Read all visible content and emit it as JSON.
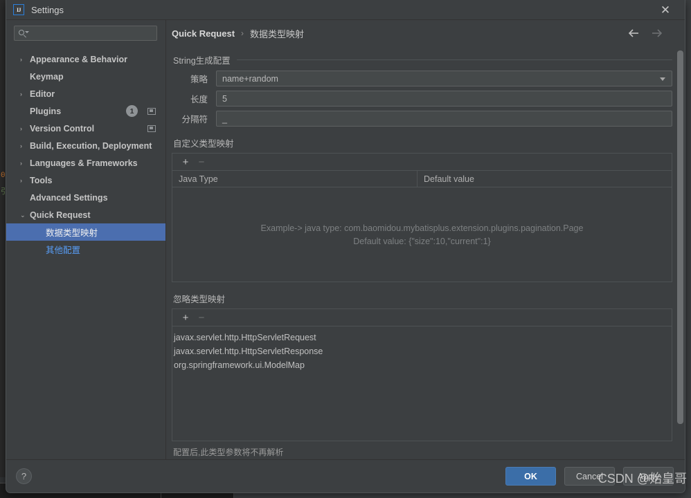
{
  "window": {
    "title": "Settings",
    "logo_text": "IJ",
    "close_icon": "✕"
  },
  "sidebar": {
    "search": {
      "value": "",
      "placeholder": ""
    },
    "items": [
      {
        "label": "Appearance & Behavior",
        "twisty": "›",
        "bold": true,
        "level": 0
      },
      {
        "label": "Keymap",
        "twisty": "",
        "bold": true,
        "level": 0
      },
      {
        "label": "Editor",
        "twisty": "›",
        "bold": true,
        "level": 0
      },
      {
        "label": "Plugins",
        "twisty": "",
        "bold": true,
        "level": 0,
        "badge": "1",
        "window_icon": true
      },
      {
        "label": "Version Control",
        "twisty": "›",
        "bold": true,
        "level": 0,
        "window_icon": true
      },
      {
        "label": "Build, Execution, Deployment",
        "twisty": "›",
        "bold": true,
        "level": 0
      },
      {
        "label": "Languages & Frameworks",
        "twisty": "›",
        "bold": true,
        "level": 0
      },
      {
        "label": "Tools",
        "twisty": "›",
        "bold": true,
        "level": 0
      },
      {
        "label": "Advanced Settings",
        "twisty": "",
        "bold": true,
        "level": 0
      },
      {
        "label": "Quick Request",
        "twisty": "⌄",
        "bold": true,
        "level": 0,
        "expanded": true
      },
      {
        "label": "数据类型映射",
        "twisty": "",
        "bold": false,
        "level": 1,
        "selected": true
      },
      {
        "label": "其他配置",
        "twisty": "",
        "bold": false,
        "level": 1,
        "link": true
      }
    ]
  },
  "breadcrumb": {
    "root": "Quick Request",
    "separator": "›",
    "leaf": "数据类型映射",
    "back_icon": "arrow-left",
    "forward_icon": "arrow-right"
  },
  "string_config": {
    "group_title": "String生成配置",
    "fields": [
      {
        "label": "策略",
        "value": "name+random",
        "type": "combo"
      },
      {
        "label": "长度",
        "value": "5",
        "type": "text"
      },
      {
        "label": "分隔符",
        "value": "_",
        "type": "text"
      }
    ]
  },
  "custom_mapping": {
    "section_label": "自定义类型映射",
    "add_label": "+",
    "remove_label": "−",
    "columns": [
      "Java Type",
      "Default value"
    ],
    "rows": [],
    "empty_hint_line1": "Example-> java type: com.baomidou.mybatisplus.extension.plugins.pagination.Page",
    "empty_hint_line2": "Default value: {\"size\":10,\"current\":1}"
  },
  "ignore_mapping": {
    "section_label": "忽略类型映射",
    "add_label": "+",
    "remove_label": "−",
    "items": [
      "javax.servlet.http.HttpServletRequest",
      "javax.servlet.http.HttpServletResponse",
      "org.springframework.ui.ModelMap"
    ],
    "note": "配置后,此类型参数将不再解析"
  },
  "footer": {
    "help_label": "?",
    "ok_label": "OK",
    "cancel_label": "Cancel",
    "apply_label": "Apply"
  },
  "watermark": "CSDN @始皇哥",
  "ide_background": {
    "code_line_1": "0",
    "code_line_2": "引"
  },
  "colors": {
    "accent_selection": "#4b6eaf",
    "primary_button": "#3b6ea8",
    "link": "#589df6",
    "panel_bg": "#3c3f41"
  }
}
